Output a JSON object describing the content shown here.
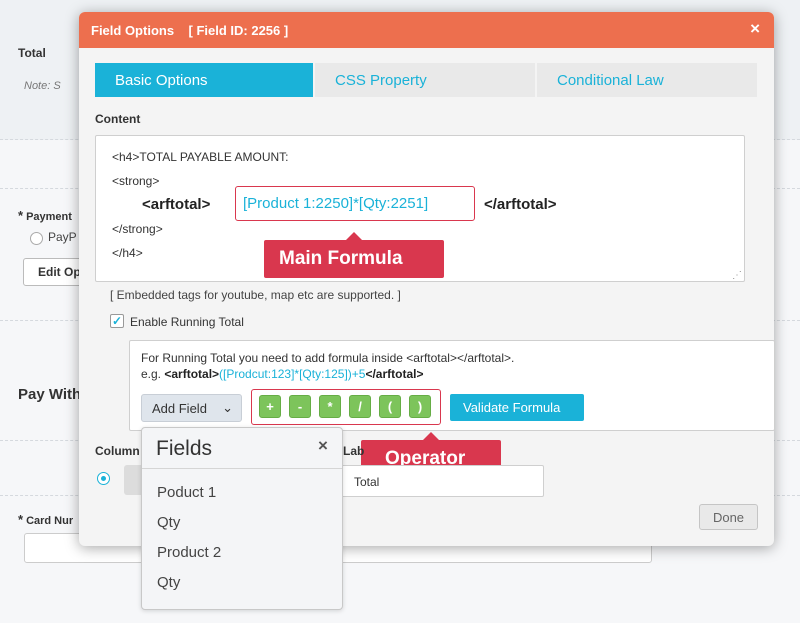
{
  "background": {
    "total_label": "Total",
    "note": "Note: S",
    "payment_label": "Payment",
    "paypal_option": "PayP",
    "edit_button": "Edit Op",
    "pay_with": "Pay With",
    "card_label": "Card Nur"
  },
  "modal": {
    "title": "Field Options",
    "field_id": "[ Field ID: 2256 ]",
    "close_glyph": "×",
    "tabs": [
      {
        "label": "Basic Options",
        "active": true
      },
      {
        "label": "CSS Property",
        "active": false
      },
      {
        "label": "Conditional Law",
        "active": false
      }
    ],
    "content_label": "Content",
    "content_lines": {
      "line1": "<h4>TOTAL PAYABLE AMOUNT:",
      "line2": "<strong>",
      "arftotal_open": "<arftotal>",
      "formula": "[Product 1:2250]*[Qty:2251]",
      "arftotal_close": "</arftotal>",
      "line4": "</strong>",
      "line5": "</h4>"
    },
    "callout_main_formula": "Main Formula",
    "embedded_note": "[ Embedded tags for youtube, map etc are supported. ]",
    "running_total": {
      "checked": true,
      "checkbox_glyph": "✓",
      "label": "Enable Running Total",
      "info": "For Running Total you need to add formula inside <arftotal></arftotal>.",
      "eg_prefix": "e.g. ",
      "eg_open": "<arftotal>",
      "eg_formula": "([Prodcut:123]*[Qty:125])+5",
      "eg_close": "</arftotal>"
    },
    "add_field_button": "Add Field",
    "add_field_chevron": "⌄",
    "operators": [
      "+",
      "-",
      "*",
      "/",
      "(",
      ")"
    ],
    "validate_button": "Validate Formula",
    "callout_operator": "Operator",
    "column_label": "Column",
    "label_label": "Lab",
    "label_value": "Total",
    "done_button": "Done"
  },
  "fields_popup": {
    "title": "Fields",
    "close_glyph": "×",
    "items": [
      "Poduct 1",
      "Qty",
      "Product 2",
      "Qty"
    ]
  },
  "colors": {
    "header": "#ed6f4e",
    "accent": "#1ab2d8",
    "callout": "#d9374e",
    "operator_button": "#7dc45b"
  }
}
